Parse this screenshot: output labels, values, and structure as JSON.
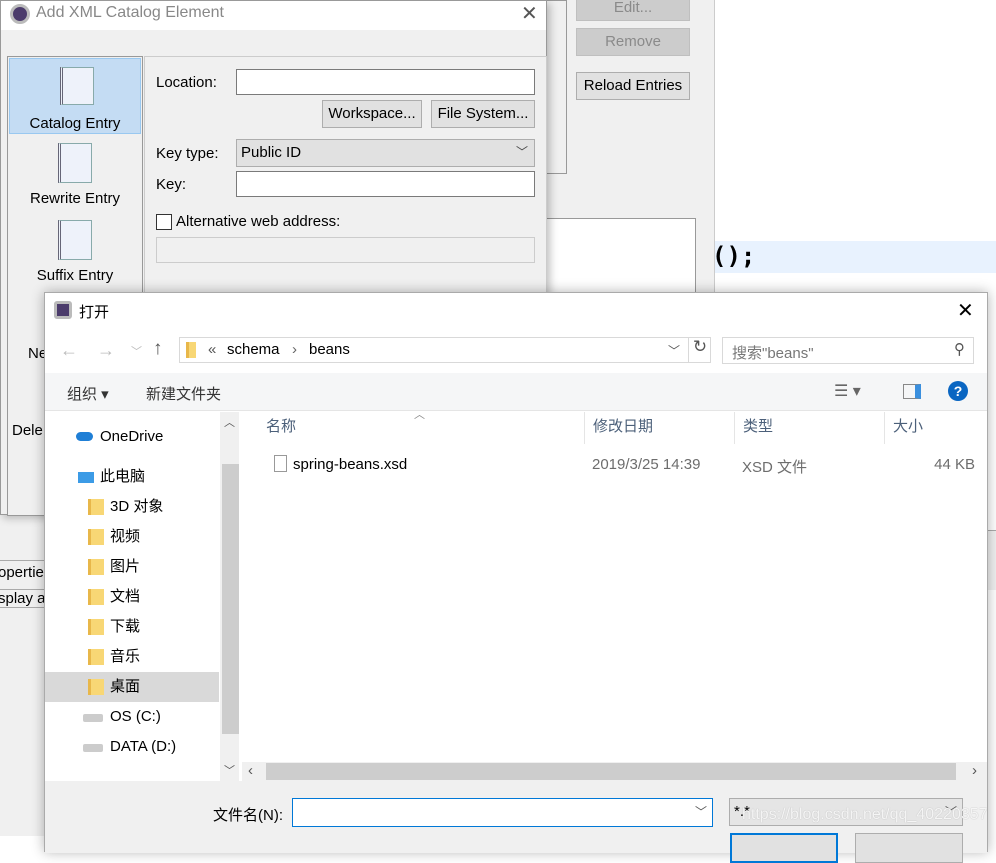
{
  "background": {
    "editor_code": "();",
    "side_texts": [
      "opertie",
      "splay a"
    ],
    "catalog_buttons": {
      "edit": "Edit...",
      "remove": "Remove",
      "reload": "Reload Entries"
    }
  },
  "catalog_dialog": {
    "title": "Add XML Catalog Element",
    "entries": [
      {
        "label": "Catalog Entry"
      },
      {
        "label": "Rewrite Entry"
      },
      {
        "label": "Suffix Entry"
      },
      {
        "label": "Ne"
      },
      {
        "label": "Dele"
      }
    ],
    "location_label": "Location:",
    "location_value": "",
    "workspace_button": "Workspace...",
    "filesystem_button": "File System...",
    "key_type_label": "Key type:",
    "key_type_value": "Public ID",
    "key_label": "Key:",
    "key_value": "",
    "alt_web_label": "Alternative web address:",
    "alt_web_checked": false
  },
  "open_dialog": {
    "title": "打开",
    "breadcrumb": {
      "prefix": "«",
      "items": [
        "schema",
        "beans"
      ]
    },
    "search_placeholder": "搜索\"beans\"",
    "toolbar": {
      "organize": "组织 ▾",
      "new_folder": "新建文件夹"
    },
    "nav": [
      {
        "label": "OneDrive",
        "icon": "cloud-icon"
      },
      {
        "label": "此电脑",
        "icon": "computer-icon"
      },
      {
        "label": "3D 对象",
        "icon": "3d-folder-icon"
      },
      {
        "label": "视频",
        "icon": "video-folder-icon"
      },
      {
        "label": "图片",
        "icon": "pictures-folder-icon"
      },
      {
        "label": "文档",
        "icon": "documents-folder-icon"
      },
      {
        "label": "下载",
        "icon": "downloads-folder-icon"
      },
      {
        "label": "音乐",
        "icon": "music-folder-icon"
      },
      {
        "label": "桌面",
        "icon": "desktop-folder-icon",
        "selected": true
      },
      {
        "label": "OS (C:)",
        "icon": "drive-icon"
      },
      {
        "label": "DATA (D:)",
        "icon": "drive-icon"
      }
    ],
    "columns": [
      "名称",
      "修改日期",
      "类型",
      "大小"
    ],
    "files": [
      {
        "name": "spring-beans.xsd",
        "modified": "2019/3/25 14:39",
        "type": "XSD 文件",
        "size": "44 KB"
      }
    ],
    "filename_label": "文件名(N):",
    "filename_value": "",
    "filter_value": "*.*"
  },
  "watermark": "https://blog.csdn.net/qq_40220357"
}
